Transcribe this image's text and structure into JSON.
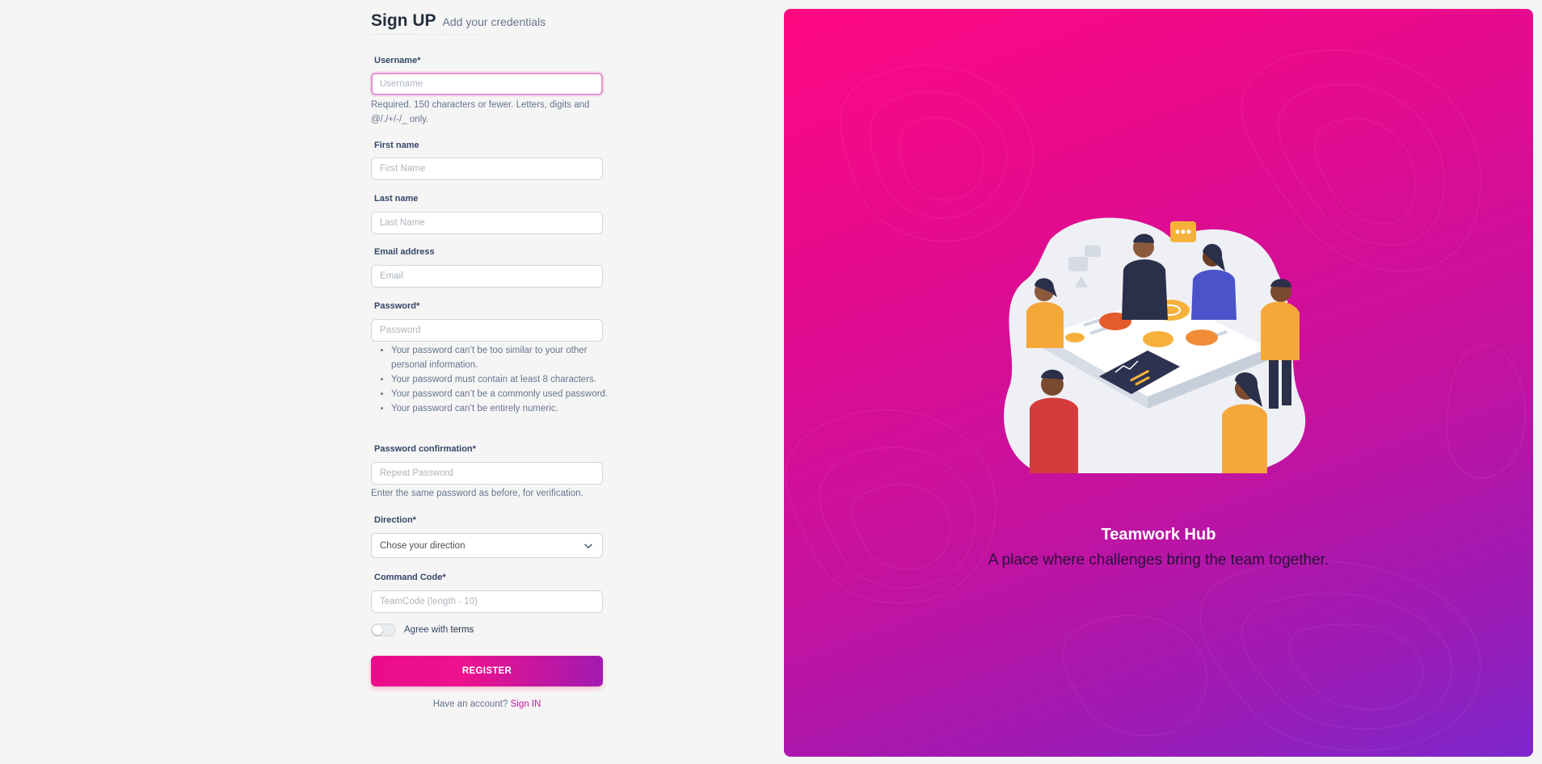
{
  "form": {
    "title": "Sign UP",
    "subtitle": "Add your credentials",
    "username": {
      "label": "Username*",
      "placeholder": "Username",
      "help": "Required. 150 characters or fewer. Letters, digits and @/./+/-/_ only."
    },
    "first_name": {
      "label": "First name",
      "placeholder": "First Name"
    },
    "last_name": {
      "label": "Last name",
      "placeholder": "Last Name"
    },
    "email": {
      "label": "Email address",
      "placeholder": "Email"
    },
    "password": {
      "label": "Password*",
      "placeholder": "Password",
      "rules": [
        "Your password can’t be too similar to your other personal information.",
        "Your password must contain at least 8 characters.",
        "Your password can’t be a commonly used password.",
        "Your password can’t be entirely numeric."
      ]
    },
    "password_confirm": {
      "label": "Password confirmation*",
      "placeholder": "Repeat Password",
      "help": "Enter the same password as before, for verification."
    },
    "direction": {
      "label": "Direction*",
      "selected": "Chose your direction"
    },
    "command_code": {
      "label": "Command Code*",
      "placeholder": "TeamCode (length - 10)"
    },
    "agree": {
      "text": "Agree with ",
      "link": "terms",
      "checked": false
    },
    "register_label": "REGISTER",
    "signin_prompt": "Have an account?",
    "signin_link": "Sign IN"
  },
  "hero": {
    "title": "Teamwork Hub",
    "subtitle": "A place where challenges bring the team together."
  },
  "colors": {
    "accent": "#e91e63",
    "gradient_start": "#ff0882",
    "gradient_end": "#7c26cb"
  }
}
